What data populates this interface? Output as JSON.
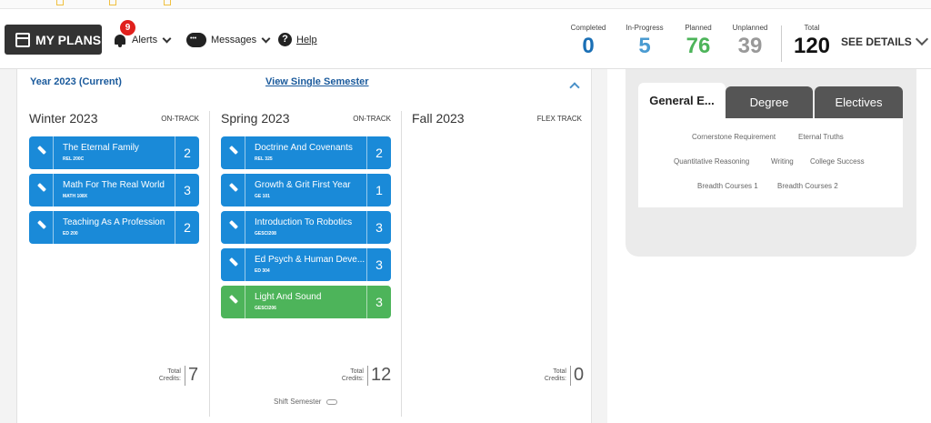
{
  "header": {
    "my_plans_label": "MY PLANS",
    "alerts": {
      "label": "Alerts",
      "count": "9"
    },
    "messages_label": "Messages",
    "help_label": "Help",
    "stats": [
      {
        "label": "Completed",
        "value": "0",
        "color": "#1a6fb5"
      },
      {
        "label": "In-Progress",
        "value": "5",
        "color": "#4a9bd1"
      },
      {
        "label": "Planned",
        "value": "76",
        "color": "#4db45a"
      },
      {
        "label": "Unplanned",
        "value": "39",
        "color": "#999999"
      },
      {
        "label": "Total",
        "value": "120",
        "color": "#111111"
      }
    ],
    "see_details_label": "SEE DETAILS"
  },
  "plan": {
    "year_title": "Year 2023 (Current)",
    "view_single_label": "View Single Semester",
    "total_credits_label": "Total Credits:",
    "shift_semester_label": "Shift Semester",
    "semesters": [
      {
        "name": "Winter 2023",
        "track": "ON-TRACK",
        "total_credits": "7",
        "courses": [
          {
            "title": "The Eternal Family",
            "code": "REL 200C",
            "credits": "2",
            "status": "blue"
          },
          {
            "title": "Math For The Real World",
            "code": "MATH 108X",
            "credits": "3",
            "status": "blue"
          },
          {
            "title": "Teaching As A Profession",
            "code": "ED 200",
            "credits": "2",
            "status": "blue"
          }
        ]
      },
      {
        "name": "Spring 2023",
        "track": "ON-TRACK",
        "total_credits": "12",
        "courses": [
          {
            "title": "Doctrine And Covenants",
            "code": "REL 325",
            "credits": "2",
            "status": "blue"
          },
          {
            "title": "Growth & Grit First Year",
            "code": "GE 101",
            "credits": "1",
            "status": "blue"
          },
          {
            "title": "Introduction To Robotics",
            "code": "GESCI208",
            "credits": "3",
            "status": "blue"
          },
          {
            "title": "Ed Psych & Human Deve...",
            "code": "ED 304",
            "credits": "3",
            "status": "blue"
          },
          {
            "title": "Light And Sound",
            "code": "GESCI206",
            "credits": "3",
            "status": "green"
          }
        ]
      },
      {
        "name": "Fall 2023",
        "track": "FLEX TRACK",
        "total_credits": "0",
        "courses": []
      }
    ]
  },
  "requirements": {
    "tabs": [
      "General E...",
      "Degree",
      "Electives"
    ],
    "links": [
      "Cornerstone Requirement",
      "Eternal Truths",
      "Quantitative Reasoning",
      "Writing",
      "College Success",
      "Breadth Courses 1",
      "Breadth Courses 2"
    ]
  }
}
